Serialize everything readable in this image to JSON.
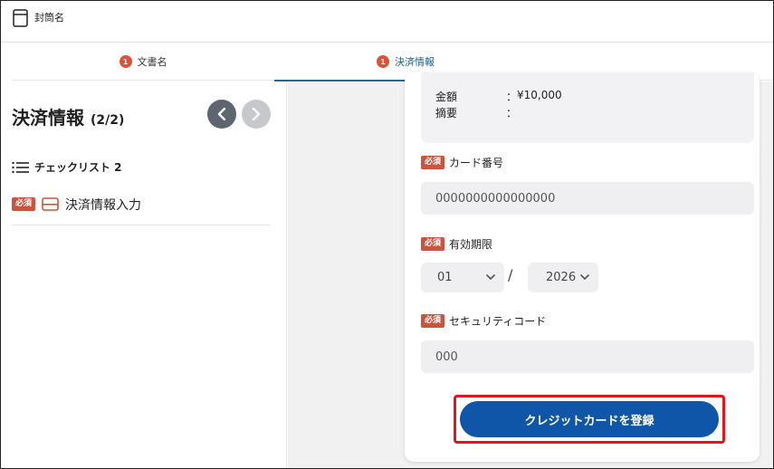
{
  "header": {
    "doc_title": "封筒名"
  },
  "tabs": [
    {
      "number": "1",
      "label": "文書名"
    },
    {
      "number": "1",
      "label": "決済情報"
    }
  ],
  "left_panel": {
    "title": "決済情報",
    "count": "(2/2)",
    "checklist_title": "チェックリスト 2",
    "items": [
      {
        "badge": "必須",
        "label": "決済情報入力"
      }
    ]
  },
  "form": {
    "summary": [
      {
        "key": "金額",
        "colon": "：",
        "value": "¥10,000"
      },
      {
        "key": "摘要",
        "colon": "：",
        "value": ""
      }
    ],
    "card_number": {
      "badge": "必須",
      "label": "カード番号",
      "value": "0000000000000000"
    },
    "expiry": {
      "badge": "必須",
      "label": "有効期限",
      "month": "01",
      "separator": "/",
      "year": "2026"
    },
    "security_code": {
      "badge": "必須",
      "label": "セキュリティコード",
      "value": "000"
    },
    "submit_label": "クレジットカードを登録"
  },
  "colors": {
    "accent_blue": "#0f56a8",
    "badge_red": "#c9553f",
    "highlight_red": "#e0161c"
  }
}
